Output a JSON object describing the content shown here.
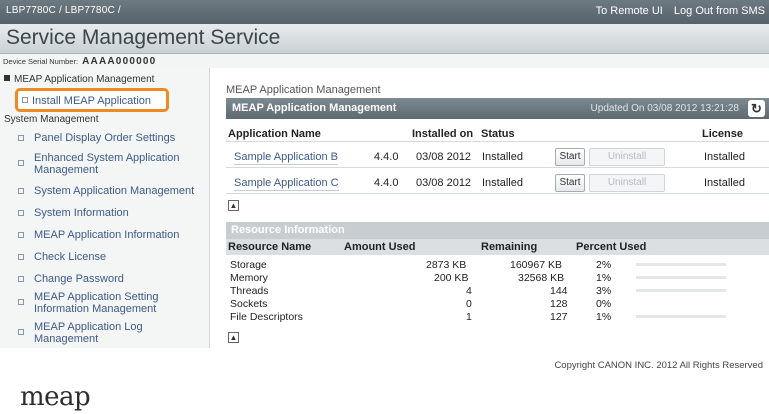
{
  "topbar": {
    "path": "LBP7780C / LBP7780C /",
    "remote_ui": "To Remote UI",
    "logout": "Log Out from SMS"
  },
  "page": {
    "title": "Service Management Service"
  },
  "device": {
    "serial_label": "Device Serial Number:",
    "serial_value": "AAAA000000"
  },
  "sidebar": {
    "section_meap": "MEAP Application Management",
    "install": "Install MEAP Application",
    "section_system": "System Management",
    "items": [
      "Panel Display Order Settings",
      "Enhanced System Application Management",
      "System Application Management",
      "System Information",
      "MEAP Application Information",
      "Check License",
      "Change Password",
      "MEAP Application Setting Information Management",
      "MEAP Application Log Management"
    ]
  },
  "main": {
    "breadcrumb": "MEAP Application Management",
    "section_title": "MEAP Application Management",
    "updated": "Updated On 03/08 2012 13:21:28",
    "columns": {
      "name": "Application Name",
      "installed_on": "Installed on",
      "status": "Status",
      "license": "License"
    },
    "apps": [
      {
        "name": "Sample Application B",
        "version": "4.4.0",
        "installed_on": "03/08 2012",
        "status": "Installed",
        "start": "Start",
        "uninstall": "Uninstall",
        "license": "Installed"
      },
      {
        "name": "Sample Application C",
        "version": "4.4.0",
        "installed_on": "03/08 2012",
        "status": "Installed",
        "start": "Start",
        "uninstall": "Uninstall",
        "license": "Installed"
      }
    ]
  },
  "resources": {
    "title": "Resource Information",
    "columns": {
      "name": "Resource Name",
      "used": "Amount Used",
      "remaining": "Remaining",
      "percent": "Percent Used"
    },
    "rows": [
      {
        "name": "Storage",
        "used": "2873 KB",
        "remaining": "160967 KB",
        "percent": "2%",
        "fraction": 0.02
      },
      {
        "name": "Memory",
        "used": "200 KB",
        "remaining": "32568 KB",
        "percent": "1%",
        "fraction": 0.01
      },
      {
        "name": "Threads",
        "used": "4",
        "remaining": "144",
        "percent": "3%",
        "fraction": 0.03
      },
      {
        "name": "Sockets",
        "used": "0",
        "remaining": "128",
        "percent": "0%",
        "fraction": 0.0
      },
      {
        "name": "File Descriptors",
        "used": "1",
        "remaining": "127",
        "percent": "1%",
        "fraction": 0.01
      }
    ]
  },
  "footer": {
    "logo": "meap",
    "copyright": "Copyright CANON INC. 2012 All Rights Reserved"
  },
  "colors": {
    "accent_highlight": "#ee8a22",
    "bar_fill": "#4cb34c",
    "header_bg": "#5e6a72"
  }
}
